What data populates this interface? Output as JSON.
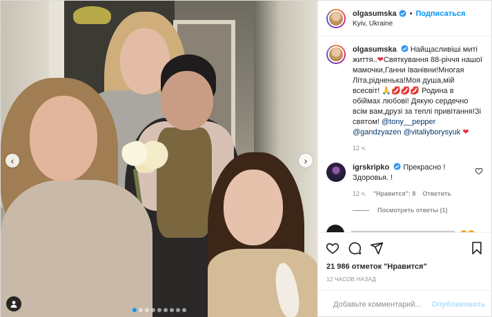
{
  "colors": {
    "accent": "#0095f6",
    "verified": "#3897f0",
    "heart": "#ed2a3e",
    "muted": "#8e8e8e"
  },
  "header": {
    "username": "olgasumska",
    "follow_label": "Подписаться",
    "separator": "•",
    "location": "Kyiv, Ukraine"
  },
  "caption": {
    "username": "olgasumska",
    "text_1": "Найщасливіші миті життя..",
    "text_2": "Святкування 88-річчя нашої мамочки,Ганни Іванівни!Многая Літа,рідненька!Моя душа,мій всесвіт!",
    "text_3": "Родина в обіймах любові! Дякую сердечно всім вам,друзі за теплі привітання!Зі святом!",
    "mention_1": "@tony__pepper",
    "mention_2": "@gandzyazen",
    "mention_3": "@vitaliyborysyuk",
    "time": "12 ч."
  },
  "comment": {
    "username": "igrskripko",
    "text": "Прекрасно ! Здоровья. !",
    "time": "12 ч.",
    "likes": "\"Нравится\": 8",
    "reply_label": "Ответить",
    "view_replies": "Посмотреть ответы (1)"
  },
  "actions": {
    "icons": [
      "heart-icon",
      "comment-icon",
      "share-icon",
      "bookmark-icon"
    ]
  },
  "likes_text": "21 986 отметок \"Нравится\"",
  "timestamp": "12 ЧАСОВ НАЗАД",
  "add_comment": {
    "placeholder": "Добавьте комментарий...",
    "publish_label": "Опубликовать"
  },
  "carousel": {
    "dot_count": 9,
    "active_index": 0
  }
}
